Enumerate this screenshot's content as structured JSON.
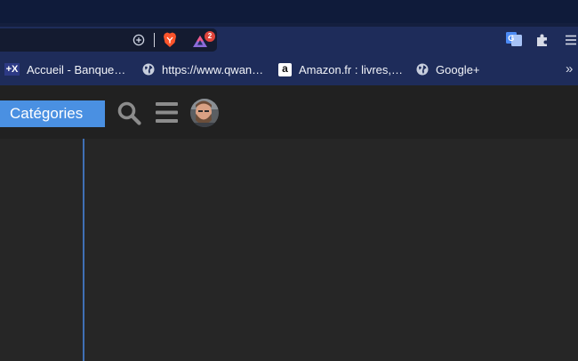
{
  "toolbar": {
    "url_value": "",
    "brave_shields_badge": "2",
    "icons": [
      "zoom-plus-icon",
      "brave-lion-icon",
      "brave-rewards-icon",
      "translate-icon",
      "extensions-puzzle-icon",
      "menu-icon"
    ]
  },
  "bookmarks": {
    "items": [
      {
        "label": "Accueil - Banque…",
        "icon": "bank-favicon"
      },
      {
        "label": "https://www.qwan…",
        "icon": "globe-icon"
      },
      {
        "label": "Amazon.fr : livres,…",
        "icon": "amazon-favicon"
      },
      {
        "label": "Google+",
        "icon": "globe-icon"
      }
    ],
    "overflow_label": "»"
  },
  "site_header": {
    "categories_label": "Catégories",
    "icons": [
      "search-icon",
      "hamburger-menu-icon",
      "avatar"
    ]
  },
  "colors": {
    "titlebar": "#0f1b3a",
    "toolbar": "#1e2c5a",
    "site_header": "#212121",
    "content": "#262626",
    "accent": "#4a90e2",
    "brave_orange": "#fb542b"
  }
}
